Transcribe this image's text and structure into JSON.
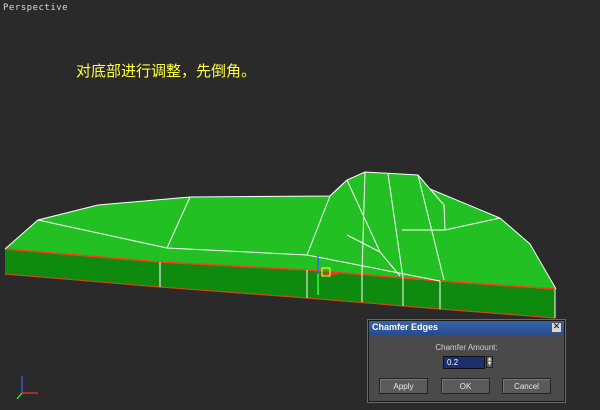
{
  "viewport": {
    "label": "Perspective",
    "caption": "对底部进行调整，先倒角。"
  },
  "gizmo": {
    "axis_x_color": "#ff3030",
    "axis_y_color": "#30ff30",
    "axis_z_color": "#4060ff"
  },
  "model": {
    "top_color": "#22c022",
    "side_color": "#0e8a0e",
    "edge_color": "#ffffff",
    "selected_edge_color": "#ff3a1a"
  },
  "dialog": {
    "title": "Chamfer Edges",
    "close_glyph": "✕",
    "amount_label": "Chamfer Amount:",
    "amount_value": "0.2",
    "apply_label": "Apply",
    "ok_label": "OK",
    "cancel_label": "Cancel"
  }
}
